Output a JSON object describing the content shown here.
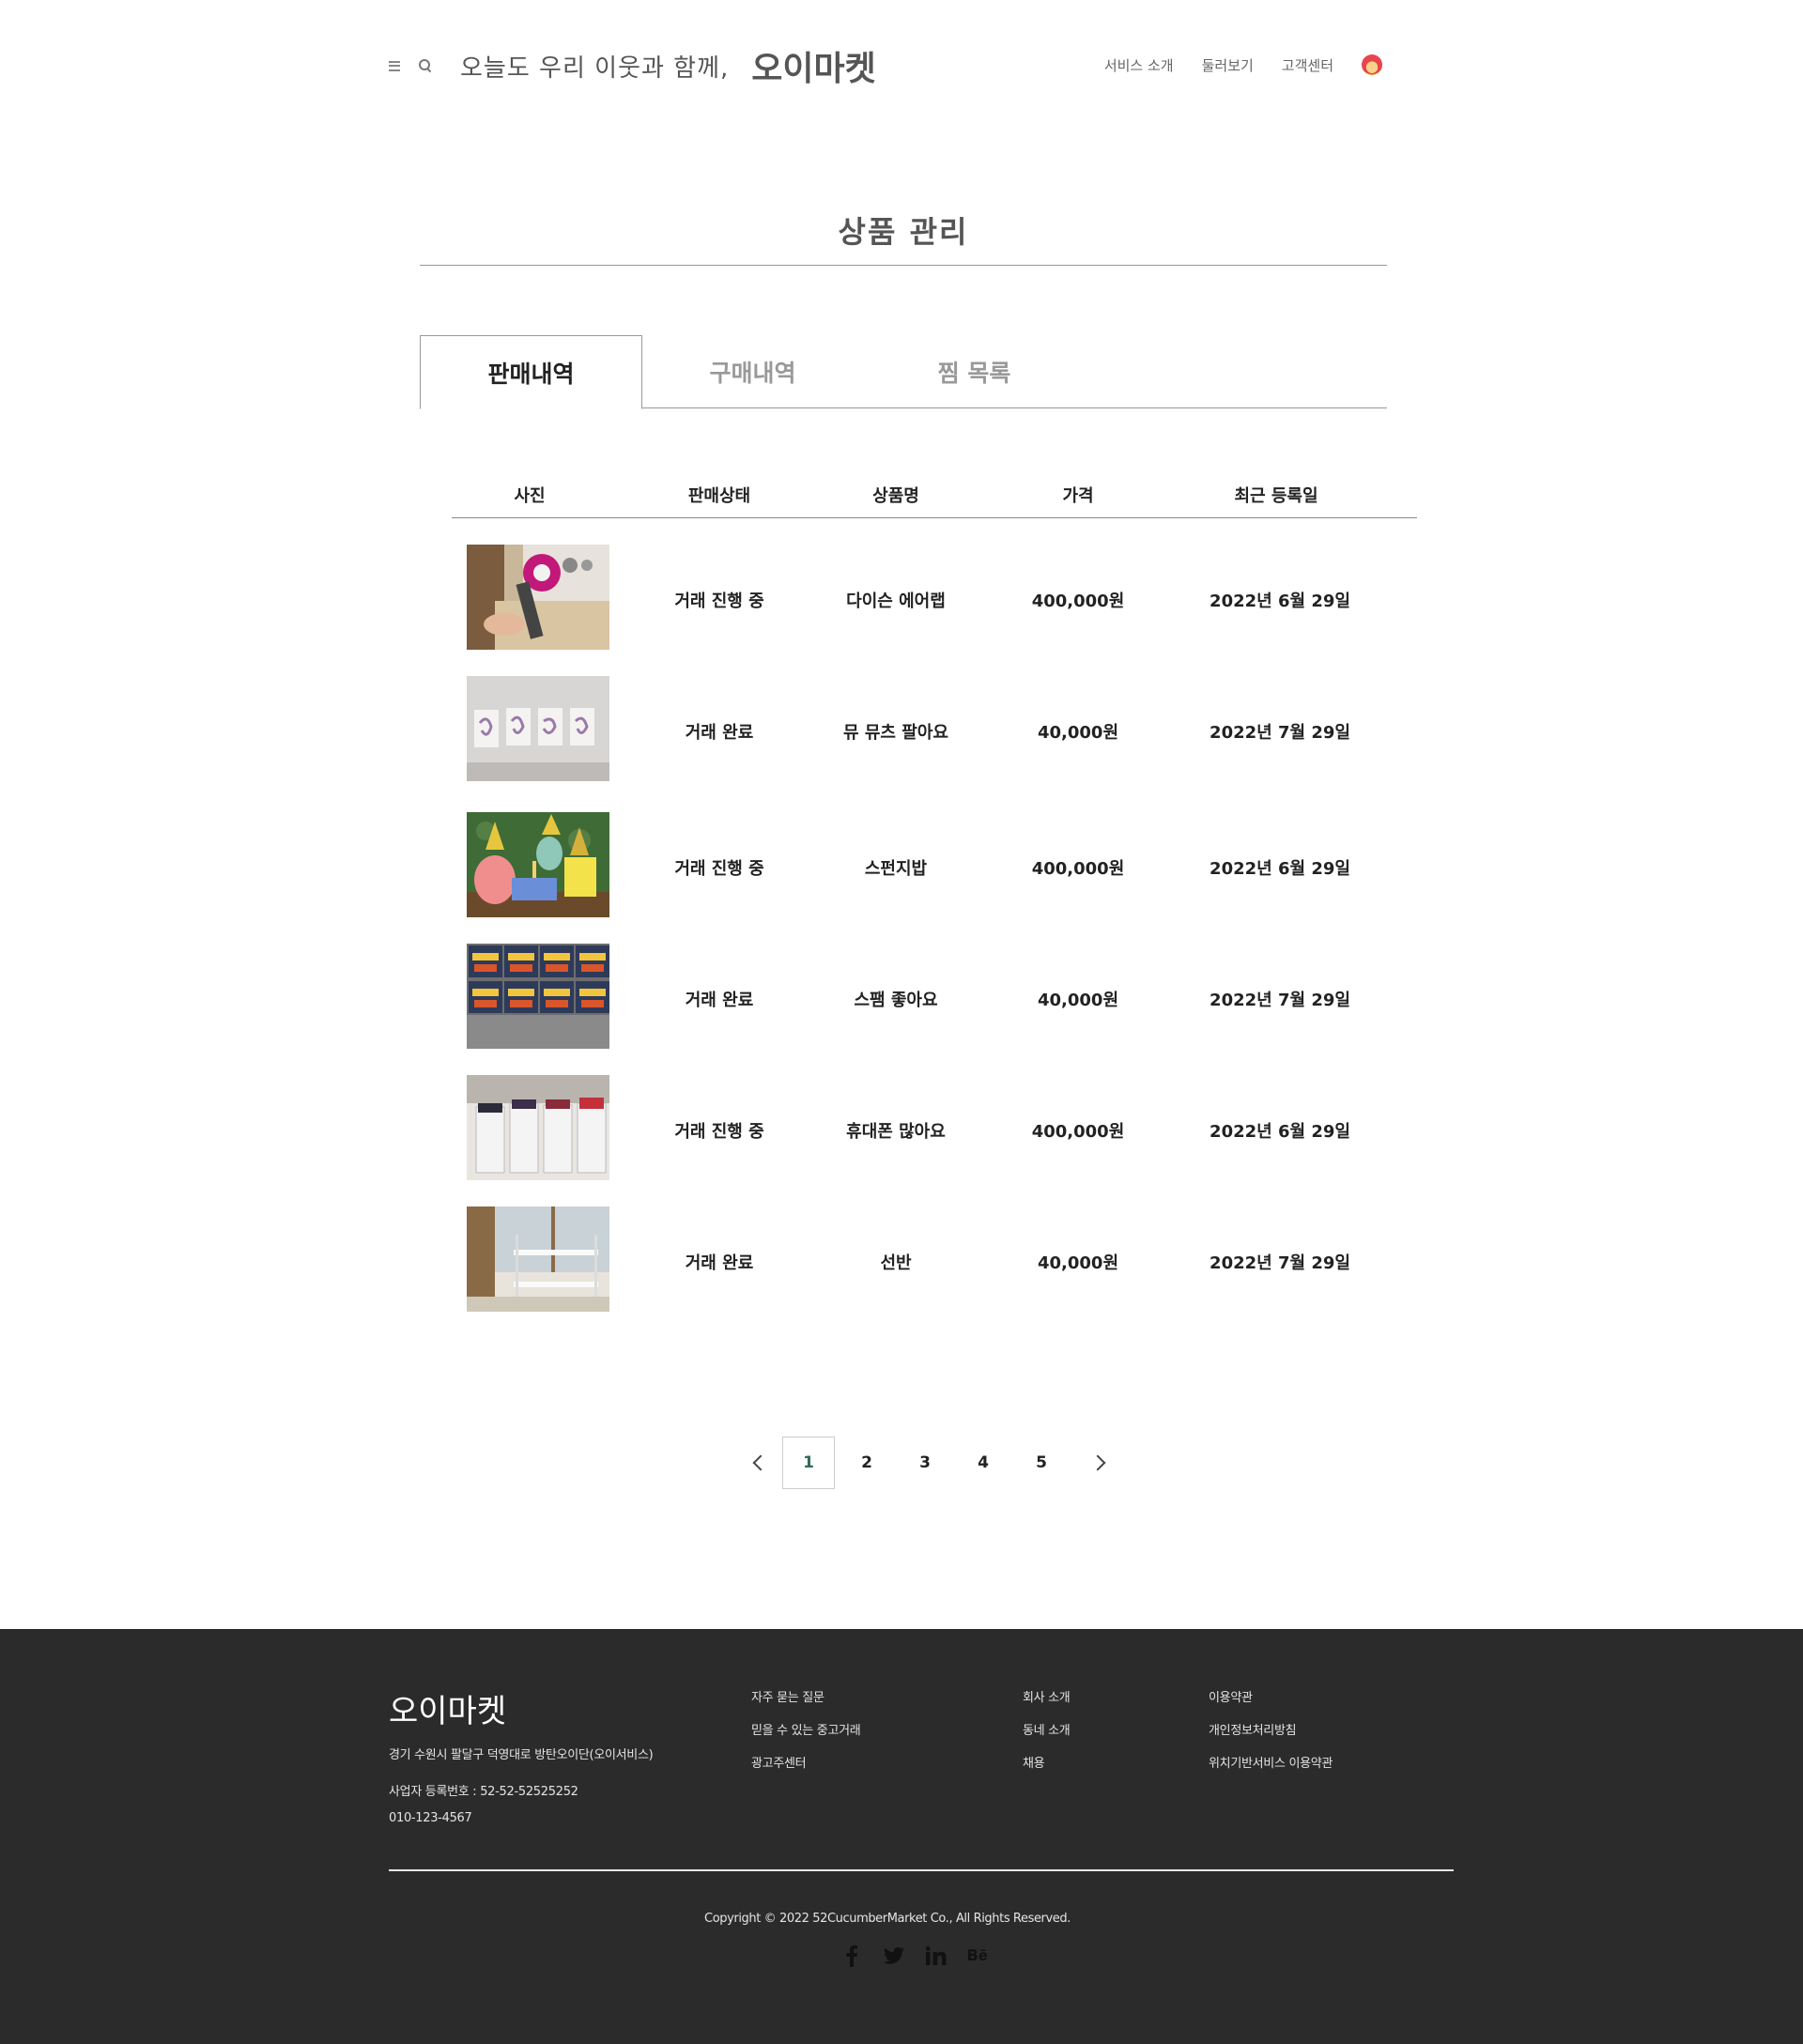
{
  "header": {
    "slogan": "오늘도 우리 이웃과 함께,",
    "brand": "오이마켓",
    "nav": [
      "서비스 소개",
      "둘러보기",
      "고객센터"
    ]
  },
  "page": {
    "title": "상품 관리"
  },
  "tabs": [
    {
      "label": "판매내역",
      "active": true
    },
    {
      "label": "구매내역",
      "active": false
    },
    {
      "label": "찜 목록",
      "active": false
    }
  ],
  "table": {
    "columns": [
      "사진",
      "판매상태",
      "상품명",
      "가격",
      "최근 등록일"
    ],
    "rows": [
      {
        "photo": "hair-dryer-box",
        "status": "거래 진행 중",
        "name": "다이슨 에어랩",
        "price": "400,000원",
        "date": "2022년 6월 29일"
      },
      {
        "photo": "mewtwo-cards",
        "status": "거래 완료",
        "name": "뮤 뮤츠 팔아요",
        "price": "40,000원",
        "date": "2022년 7월 29일"
      },
      {
        "photo": "spongebob-party",
        "status": "거래 진행 중",
        "name": "스펀지밥",
        "price": "400,000원",
        "date": "2022년 6월 29일"
      },
      {
        "photo": "spam-cans",
        "status": "거래 완료",
        "name": "스팸 좋아요",
        "price": "40,000원",
        "date": "2022년 7월 29일"
      },
      {
        "photo": "phone-boxes",
        "status": "거래 진행 중",
        "name": "휴대폰 많아요",
        "price": "400,000원",
        "date": "2022년 6월 29일"
      },
      {
        "photo": "shelf",
        "status": "거래 완료",
        "name": "선반",
        "price": "40,000원",
        "date": "2022년 7월 29일"
      }
    ]
  },
  "pagination": {
    "pages": [
      "1",
      "2",
      "3",
      "4",
      "5"
    ],
    "current": "1"
  },
  "footer": {
    "brand": "오이마켓",
    "address": "경기 수원시 팔달구 덕영대로 방탄오이단(오이서비스)",
    "business_no": "사업자 등록번호 : 52-52-52525252",
    "phone": "010-123-4567",
    "col1": [
      "자주 묻는 질문",
      "믿을 수 있는 중고거래",
      "광고주센터"
    ],
    "col2": [
      "회사 소개",
      "동네 소개",
      "채용"
    ],
    "col3": [
      "이용약관",
      "개인정보처리방침",
      "위치기반서비스 이용약관"
    ],
    "copyright": "Copyright © 2022 52CucumberMarket Co., All Rights Reserved.",
    "social": [
      {
        "icon": "facebook-icon",
        "glyph": "f"
      },
      {
        "icon": "twitter-icon",
        "glyph": "🐦"
      },
      {
        "icon": "linkedin-icon",
        "glyph": "in"
      },
      {
        "icon": "behance-icon",
        "glyph": "Bē"
      }
    ]
  },
  "colors": {
    "footer_bg": "#2b2b2b",
    "active_page": "#2e6b5a"
  }
}
